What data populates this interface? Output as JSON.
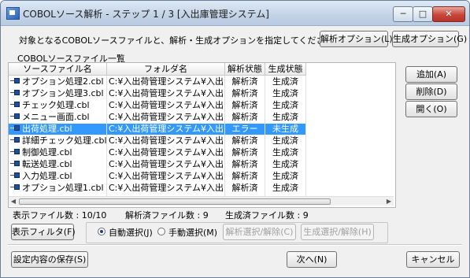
{
  "window": {
    "title": "COBOLソース解析 - ステップ 1 / 3 [入出庫管理システム]",
    "min_glyph": "─",
    "max_glyph": "□",
    "close_glyph": "✕"
  },
  "instruction": "対象となるCOBOLソースファイルと、解析・生成オプションを指定してください。",
  "top_buttons": {
    "analyze_option": "解析オプション(L)",
    "generate_option": "生成オプション(G)"
  },
  "list": {
    "caption": "COBOLソースファイル一覧",
    "columns": [
      "ソースファイル名",
      "フォルダ名",
      "解析状態",
      "生成状態"
    ],
    "rows": [
      {
        "file": "オプション処理2.cbl",
        "folder": "C:¥入出荷管理システム¥入出…",
        "parse": "解析済",
        "gen": "生成済",
        "selected": false
      },
      {
        "file": "オプション処理3.cbl",
        "folder": "C:¥入出荷管理システム¥入出…",
        "parse": "解析済",
        "gen": "生成済",
        "selected": false
      },
      {
        "file": "チェック処理.cbl",
        "folder": "C:¥入出荷管理システム¥入出…",
        "parse": "解析済",
        "gen": "生成済",
        "selected": false
      },
      {
        "file": "メニュー画面.cbl",
        "folder": "C:¥入出荷管理システム¥入出…",
        "parse": "解析済",
        "gen": "生成済",
        "selected": false
      },
      {
        "file": "出荷処理.cbl",
        "folder": "C:¥入出荷管理システム¥入出…",
        "parse": "エラー",
        "gen": "未生成",
        "selected": true
      },
      {
        "file": "詳細チェック処理.cbl",
        "folder": "C:¥入出荷管理システム¥入出…",
        "parse": "解析済",
        "gen": "生成済",
        "selected": false
      },
      {
        "file": "制御処理.cbl",
        "folder": "C:¥入出荷管理システム¥入出…",
        "parse": "解析済",
        "gen": "生成済",
        "selected": false
      },
      {
        "file": "転送処理.cbl",
        "folder": "C:¥入出荷管理システム¥入出…",
        "parse": "解析済",
        "gen": "生成済",
        "selected": false
      },
      {
        "file": "入力処理.cbl",
        "folder": "C:¥入出荷管理システム¥入出…",
        "parse": "解析済",
        "gen": "生成済",
        "selected": false
      },
      {
        "file": "オプション処理1.cbl",
        "folder": "C:¥入出荷管理システム¥入出…",
        "parse": "解析済",
        "gen": "生成済",
        "selected": false
      }
    ],
    "scroll_left_glyph": "◀",
    "scroll_right_glyph": "▶"
  },
  "side_buttons": {
    "add": "追加(A)",
    "delete": "削除(D)",
    "open": "開く(O)"
  },
  "status": {
    "displayed": "表示ファイル数 : 10/10",
    "parsed": "解析済ファイル数 : 9",
    "generated": "生成済ファイル数 : 9"
  },
  "filter_button": "表示フィルタ(F)",
  "mode": {
    "auto": "自動選択(J)",
    "manual": "手動選択(M)",
    "auto_selected": true,
    "parse_toggle": "解析選択/解除(C)",
    "gen_toggle": "生成選択/解除(H)"
  },
  "bottom": {
    "save": "設定内容の保存(S)",
    "next": "次へ(N)",
    "cancel": "キャンセル"
  },
  "colors": {
    "selection": "#3399ff",
    "window_bg": "#f0f0f0",
    "close_button": "#c7453a"
  }
}
